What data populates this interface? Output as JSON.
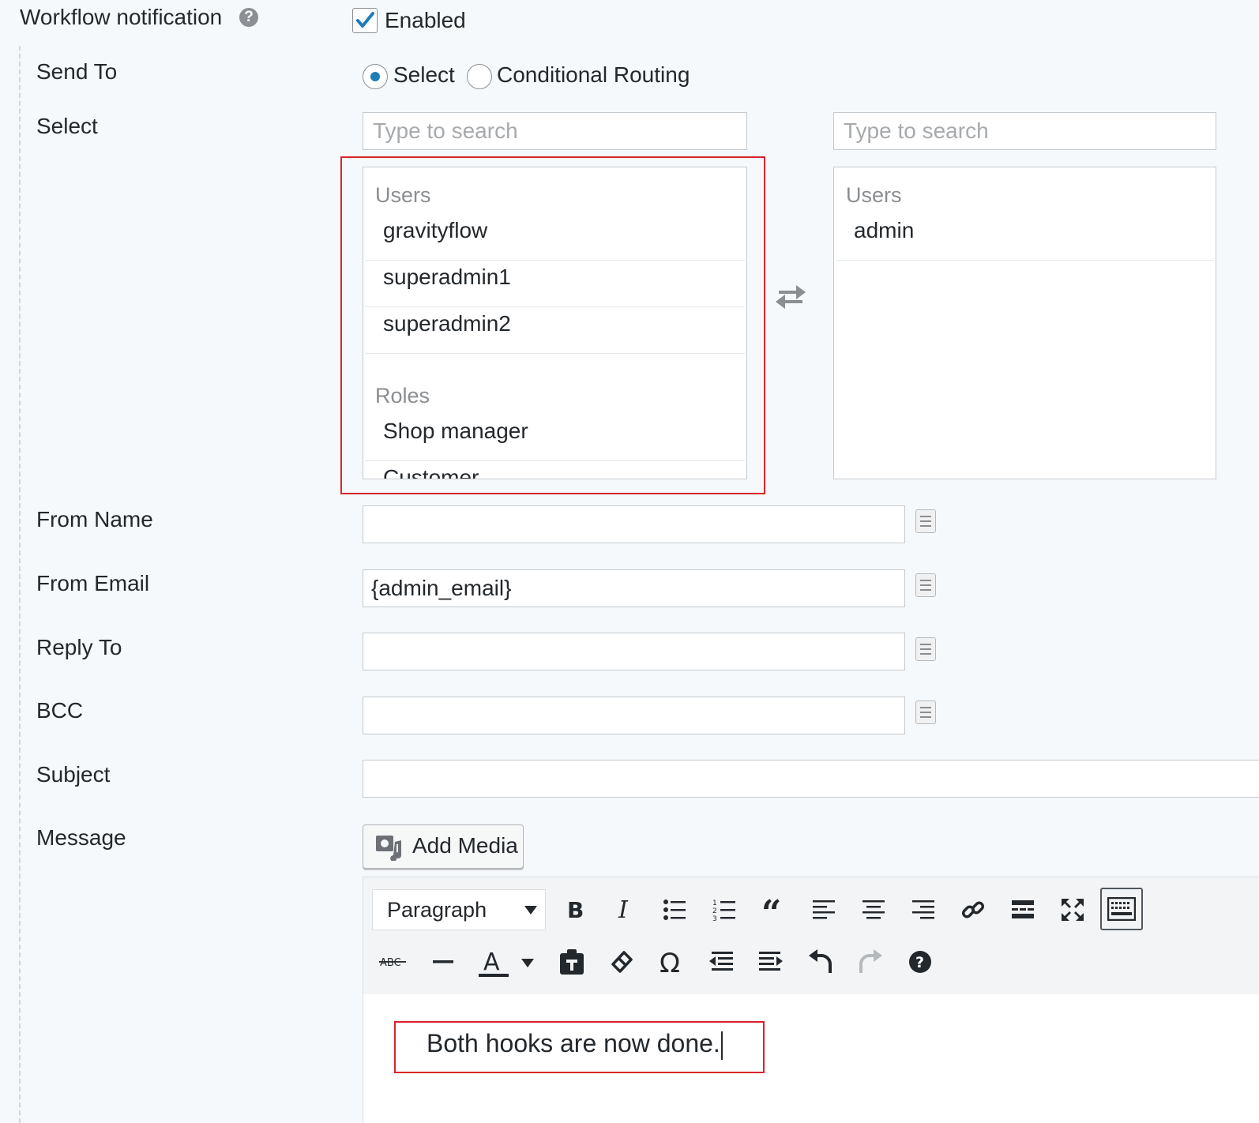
{
  "workflow_notification": {
    "label": "Workflow notification",
    "enabled_label": "Enabled",
    "enabled": true
  },
  "form": {
    "send_to": {
      "label": "Send To",
      "options": [
        "Select",
        "Conditional Routing"
      ],
      "selected": "Select"
    },
    "select": {
      "label": "Select",
      "left": {
        "search_placeholder": "Type to search",
        "users_label": "Users",
        "users": [
          "gravityflow",
          "superadmin1",
          "superadmin2"
        ],
        "roles_label": "Roles",
        "roles": [
          "Shop manager",
          "Customer"
        ]
      },
      "right": {
        "search_placeholder": "Type to search",
        "users_label": "Users",
        "users": [
          "admin"
        ]
      }
    },
    "from_name": {
      "label": "From Name",
      "value": ""
    },
    "from_email": {
      "label": "From Email",
      "value": "{admin_email}"
    },
    "reply_to": {
      "label": "Reply To",
      "value": ""
    },
    "bcc": {
      "label": "BCC",
      "value": ""
    },
    "subject": {
      "label": "Subject",
      "value": ""
    },
    "message": {
      "label": "Message",
      "add_media_label": "Add Media",
      "format_select": "Paragraph",
      "content": "Both hooks are now done."
    }
  },
  "colors": {
    "accent": "#1e7cba",
    "highlight": "#d9232d",
    "background": "#f5f9fb"
  },
  "icons": {
    "toolbar_row1": [
      "bold-icon",
      "italic-icon",
      "bullet-list-icon",
      "numbered-list-icon",
      "blockquote-icon",
      "align-left-icon",
      "align-center-icon",
      "align-right-icon",
      "link-icon",
      "read-more-icon",
      "fullscreen-icon",
      "toolbar-toggle-icon"
    ],
    "toolbar_row2": [
      "strikethrough-icon",
      "horizontal-line-icon",
      "text-color-icon",
      "paste-text-icon",
      "clear-format-icon",
      "special-char-icon",
      "outdent-icon",
      "indent-icon",
      "undo-icon",
      "redo-icon",
      "help-icon"
    ]
  }
}
